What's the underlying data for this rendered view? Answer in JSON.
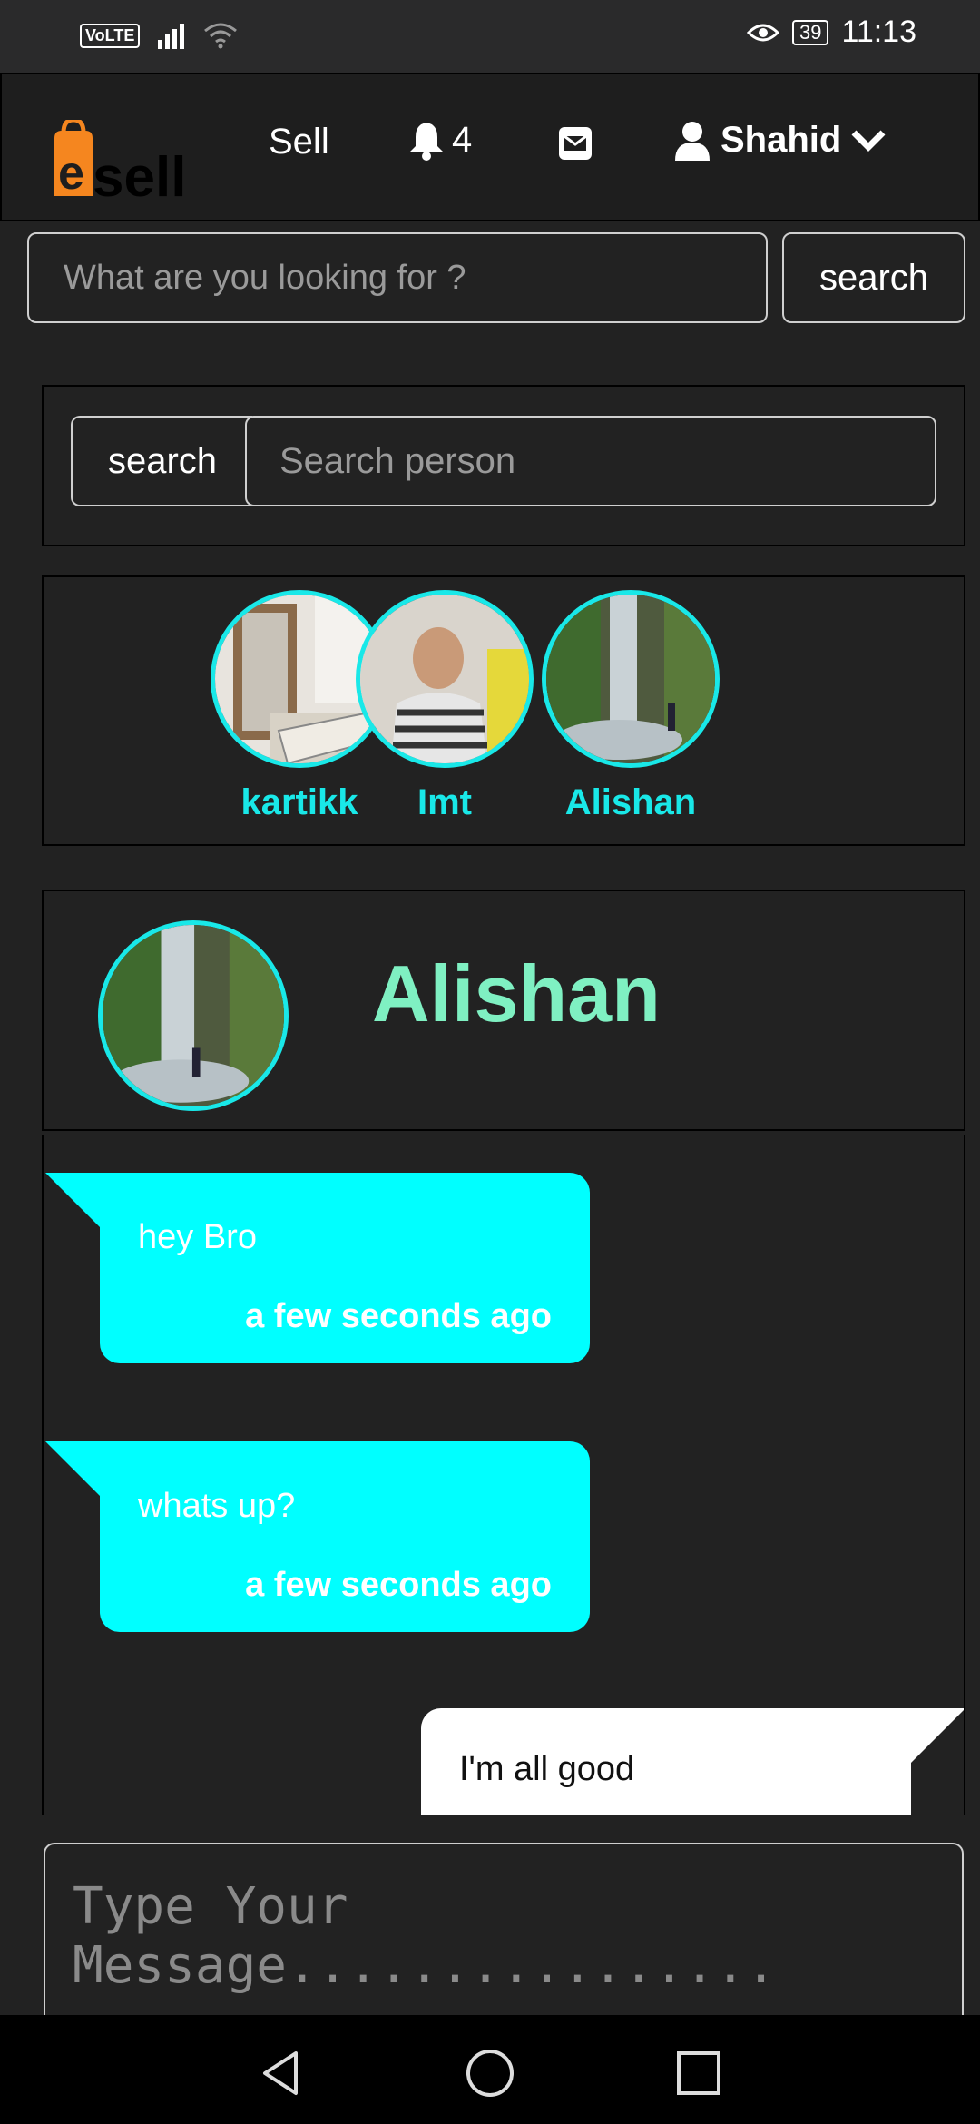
{
  "status_bar": {
    "volte": "VoLTE",
    "battery": "39",
    "time": "11:13"
  },
  "navbar": {
    "logo_text": "sell",
    "sell_label": "Sell",
    "notification_count": "4",
    "user_name": "Shahid"
  },
  "top_search": {
    "placeholder": "What are you looking for ?",
    "button_label": "search"
  },
  "person_search": {
    "button_label": "search",
    "placeholder": "Search person"
  },
  "contacts": [
    {
      "name": "kartikk"
    },
    {
      "name": "Imt"
    },
    {
      "name": "Alishan"
    }
  ],
  "chat": {
    "contact_name": "Alishan",
    "messages": [
      {
        "text": "hey Bro",
        "time": "a few seconds ago",
        "direction": "incoming"
      },
      {
        "text": "whats up?",
        "time": "a few seconds ago",
        "direction": "incoming"
      },
      {
        "text": "I'm all good",
        "direction": "outgoing"
      }
    ]
  },
  "composer": {
    "placeholder": "Type Your Message................"
  },
  "colors": {
    "accent": "#19e8e8",
    "bubble_in": "#00ffff",
    "chat_name": "#7ff0c2",
    "logo_orange": "#f5861f"
  }
}
